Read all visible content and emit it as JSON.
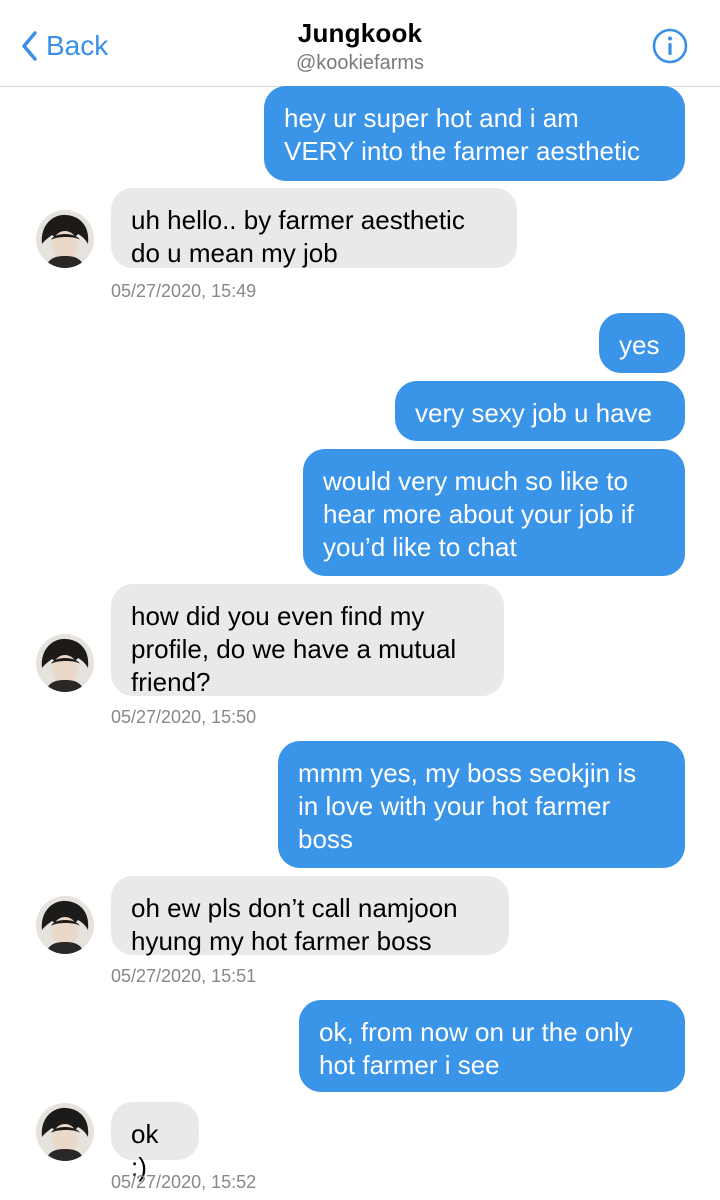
{
  "header": {
    "back_label": "Back",
    "title": "Jungkook",
    "handle": "@kookiefarms"
  },
  "colors": {
    "accent": "#3a90e6",
    "outgoing_bubble": "#3a94e8",
    "incoming_bubble": "#e9e9eb"
  },
  "icons": {
    "back": "chevron-left-icon",
    "info": "info-circle-icon"
  },
  "messages": [
    {
      "from": "me",
      "text": "hey ur super hot and i am\nVERY into the farmer aesthetic"
    },
    {
      "from": "them",
      "text": "uh hello.. by farmer aesthetic\ndo u mean my job",
      "timestamp": "05/27/2020, 15:49"
    },
    {
      "from": "me",
      "text": "yes"
    },
    {
      "from": "me",
      "text": "very sexy job u have"
    },
    {
      "from": "me",
      "text": "would very much so like to\nhear more about your job if\nyou’d like to chat"
    },
    {
      "from": "them",
      "text": "how did you even find my\nprofile, do we have a mutual\nfriend?",
      "timestamp": "05/27/2020, 15:50"
    },
    {
      "from": "me",
      "text": "mmm yes, my boss seokjin is\nin love with your hot farmer\nboss"
    },
    {
      "from": "them",
      "text": "oh ew pls don’t call namjoon\nhyung my hot farmer boss",
      "timestamp": "05/27/2020, 15:51"
    },
    {
      "from": "me",
      "text": "ok, from now on ur the only\nhot farmer i see"
    },
    {
      "from": "them",
      "text": "ok :)",
      "timestamp": "05/27/2020, 15:52"
    }
  ]
}
